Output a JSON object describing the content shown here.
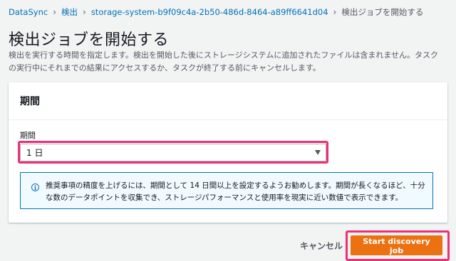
{
  "breadcrumb": {
    "items": [
      "DataSync",
      "検出",
      "storage-system-b9f09c4a-2b50-486d-8464-a89ff6641d04"
    ],
    "current": "検出ジョブを開始する"
  },
  "page": {
    "title": "検出ジョブを開始する",
    "description": "検出を実行する時間を指定します。検出を開始した後にストレージシステムに追加されたファイルは含まれません。タスクの実行中にそれまでの結果にアクセスするか、タスクが終了する前にキャンセルします。"
  },
  "panel": {
    "title": "期間",
    "duration_label": "期間",
    "duration_value": "1 日",
    "info_text": "推奨事項の精度を上げるには、期間として 14 日間以上を設定するようお勧めします。期間が長くなるほど、十分な数のデータポイントを収集でき、ストレージパフォーマンスと使用率を現実に近い数値で表示できます。"
  },
  "actions": {
    "cancel_label": "キャンセル",
    "start_label": "Start discovery job"
  },
  "colors": {
    "link": "#0073bb",
    "primary_button": "#ec7211",
    "highlight": "#ed2f77",
    "info_background": "#f1faff"
  }
}
